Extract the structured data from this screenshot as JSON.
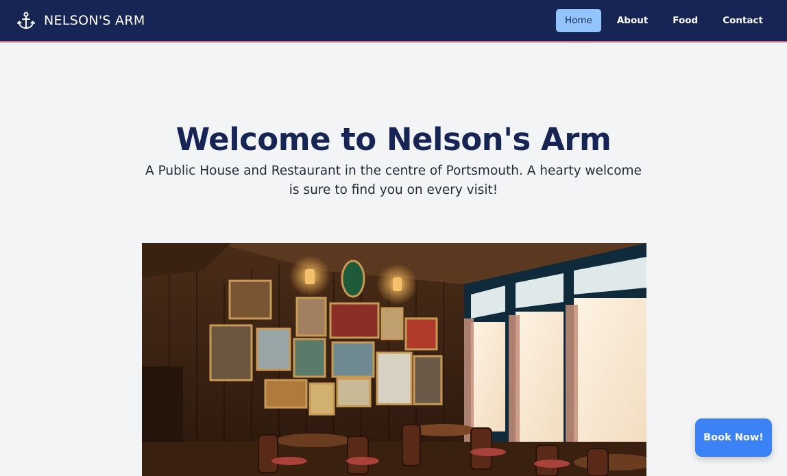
{
  "brand": {
    "name": "NELSON'S ARM",
    "icon": "anchor-icon"
  },
  "nav": {
    "items": [
      {
        "label": "Home",
        "active": true
      },
      {
        "label": "About",
        "active": false
      },
      {
        "label": "Food",
        "active": false
      },
      {
        "label": "Contact",
        "active": false
      }
    ]
  },
  "hero": {
    "title": "Welcome to Nelson's Arm",
    "subtitle": "A Public House and Restaurant in the centre of Portsmouth. A hearty welcome is sure to find you on every visit!"
  },
  "cta": {
    "book_label": "Book Now!"
  },
  "colors": {
    "navbar": "#172554",
    "navbar_border": "#e0637a",
    "active_link": "#93c5fd",
    "heading": "#172554",
    "page_bg": "#f3f4f6",
    "cta": "#3b82f6"
  }
}
